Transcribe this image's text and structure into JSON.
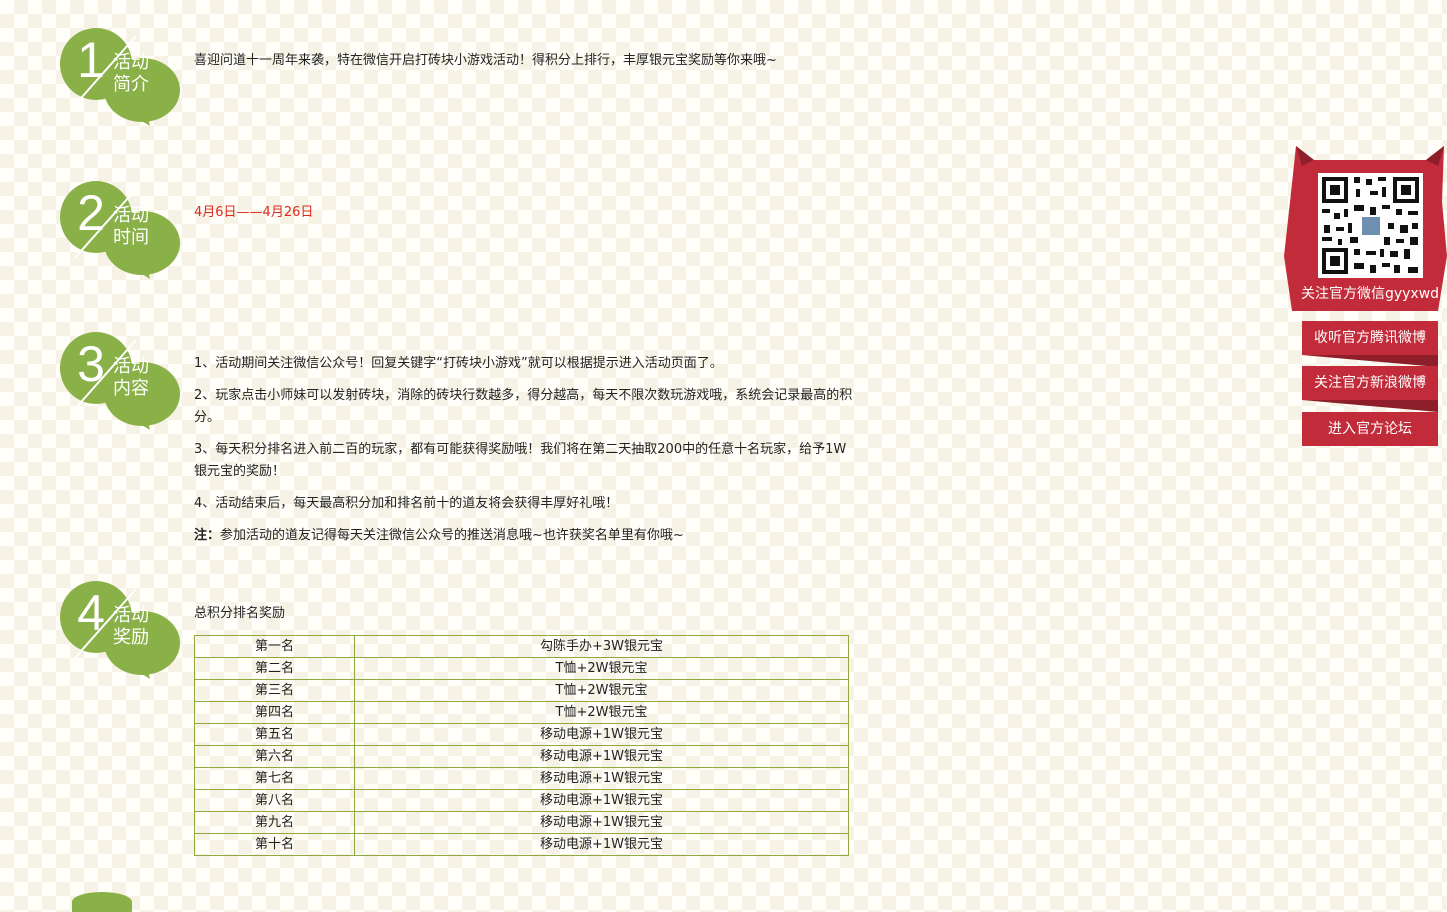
{
  "sections": [
    {
      "number": "1",
      "label_line1": "活动",
      "label_line2": "简介"
    },
    {
      "number": "2",
      "label_line1": "活动",
      "label_line2": "时间"
    },
    {
      "number": "3",
      "label_line1": "活动",
      "label_line2": "内容"
    },
    {
      "number": "4",
      "label_line1": "活动",
      "label_line2": "奖励"
    }
  ],
  "intro": {
    "text": "喜迎问道十一周年来袭，特在微信开启打砖块小游戏活动！得积分上排行，丰厚银元宝奖励等你来哦~"
  },
  "time": {
    "text": "4月6日——4月26日"
  },
  "content": {
    "items": [
      "1、活动期间关注微信公众号！回复关键字“打砖块小游戏”就可以根据提示进入活动页面了。",
      "2、玩家点击小师妹可以发射砖块，消除的砖块行数越多，得分越高，每天不限次数玩游戏哦，系统会记录最高的积分。",
      "3、每天积分排名进入前二百的玩家，都有可能获得奖励哦！我们将在第二天抽取200中的任意十名玩家，给予1W银元宝的奖励！",
      "4、活动结束后，每天最高积分加和排名前十的道友将会获得丰厚好礼哦！"
    ],
    "note_label": "注：",
    "note_text": "参加活动的道友记得每天关注微信公众号的推送消息哦~也许获奖名单里有你哦~"
  },
  "rewards": {
    "caption": "总积分排名奖励",
    "rows": [
      {
        "rank": "第一名",
        "prize": "勾陈手办+3W银元宝"
      },
      {
        "rank": "第二名",
        "prize": "T恤+2W银元宝"
      },
      {
        "rank": "第三名",
        "prize": "T恤+2W银元宝"
      },
      {
        "rank": "第四名",
        "prize": "T恤+2W银元宝"
      },
      {
        "rank": "第五名",
        "prize": "移动电源+1W银元宝"
      },
      {
        "rank": "第六名",
        "prize": "移动电源+1W银元宝"
      },
      {
        "rank": "第七名",
        "prize": "移动电源+1W银元宝"
      },
      {
        "rank": "第八名",
        "prize": "移动电源+1W银元宝"
      },
      {
        "rank": "第九名",
        "prize": "移动电源+1W银元宝"
      },
      {
        "rank": "第十名",
        "prize": "移动电源+1W银元宝"
      }
    ]
  },
  "side_panel": {
    "qr_caption": "关注官方微信gyyxwd",
    "buttons": [
      "收听官方腾讯微博",
      "关注官方新浪微博",
      "进入官方论坛"
    ]
  },
  "colors": {
    "badge_green": "#8ab148",
    "badge_green_dark": "#6f9436",
    "date_red": "#e0281e",
    "table_border": "#8fa93f",
    "ribbon_red": "#c22c3a",
    "ribbon_red_dark": "#8e1e29"
  }
}
